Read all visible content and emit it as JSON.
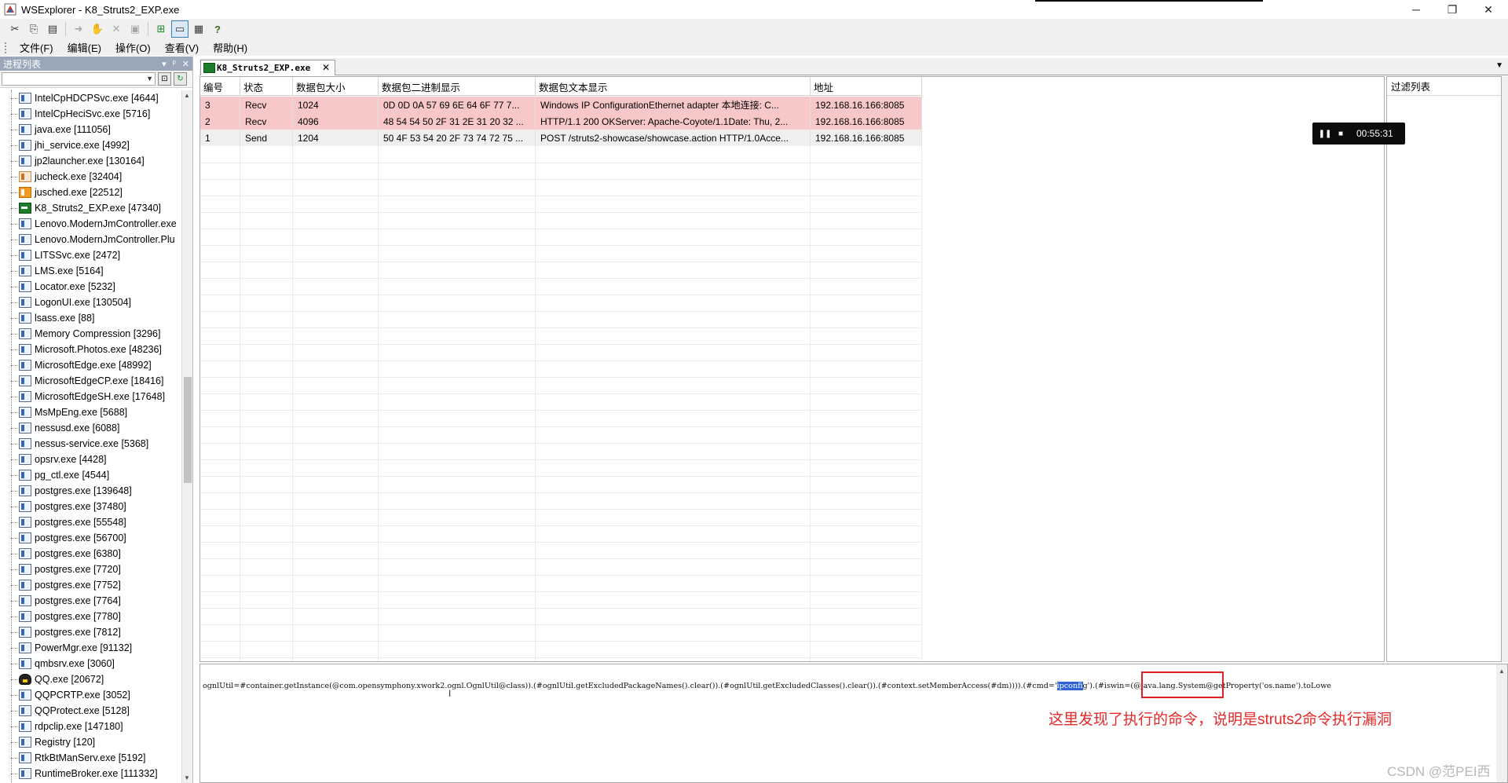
{
  "window": {
    "title": "WSExplorer - K8_Struts2_EXP.exe",
    "controls": {
      "minimize": "─",
      "restore": "❐",
      "close": "✕"
    }
  },
  "toolbar": {
    "buttons": [
      {
        "icon": "cut-icon",
        "glyph": "✂"
      },
      {
        "icon": "copy-icon",
        "glyph": "⎘"
      },
      {
        "icon": "paste-icon",
        "glyph": "▤"
      },
      {
        "icon": "forward-icon",
        "glyph": "➜"
      },
      {
        "icon": "hand-icon",
        "glyph": "✋"
      },
      {
        "icon": "delete-icon",
        "glyph": "✕"
      },
      {
        "icon": "save-icon",
        "glyph": "▣"
      },
      {
        "icon": "tree-view-icon",
        "glyph": "⊞"
      },
      {
        "icon": "window-icon",
        "glyph": "▭"
      },
      {
        "icon": "properties-icon",
        "glyph": "▦"
      },
      {
        "icon": "help-icon",
        "glyph": "?"
      }
    ]
  },
  "menubar": {
    "items": [
      "文件(F)",
      "编辑(E)",
      "操作(O)",
      "查看(V)",
      "帮助(H)"
    ]
  },
  "process_panel": {
    "title": "进程列表",
    "header_buttons": [
      "▾",
      "ᵖ",
      "✕"
    ],
    "processes": [
      {
        "label": "IntelCpHDCPSvc.exe [4644]",
        "icon": "app-icon"
      },
      {
        "label": "IntelCpHeciSvc.exe [5716]",
        "icon": "app-icon"
      },
      {
        "label": "java.exe [111056]",
        "icon": "app-icon"
      },
      {
        "label": "jhi_service.exe [4992]",
        "icon": "app-icon"
      },
      {
        "label": "jp2launcher.exe [130164]",
        "icon": "app-icon"
      },
      {
        "label": "jucheck.exe [32404]",
        "icon": "java-icon"
      },
      {
        "label": "jusched.exe [22512]",
        "icon": "java-orange-icon"
      },
      {
        "label": "K8_Struts2_EXP.exe [47340]",
        "icon": "k8-icon"
      },
      {
        "label": "Lenovo.ModernJmController.exe",
        "icon": "app-icon"
      },
      {
        "label": "Lenovo.ModernJmController.Plu",
        "icon": "app-icon"
      },
      {
        "label": "LITSSvc.exe [2472]",
        "icon": "app-icon"
      },
      {
        "label": "LMS.exe [5164]",
        "icon": "app-icon"
      },
      {
        "label": "Locator.exe [5232]",
        "icon": "app-icon"
      },
      {
        "label": "LogonUI.exe [130504]",
        "icon": "app-icon"
      },
      {
        "label": "lsass.exe [88]",
        "icon": "app-icon"
      },
      {
        "label": "Memory Compression [3296]",
        "icon": "app-icon"
      },
      {
        "label": "Microsoft.Photos.exe [48236]",
        "icon": "app-icon"
      },
      {
        "label": "MicrosoftEdge.exe [48992]",
        "icon": "app-icon"
      },
      {
        "label": "MicrosoftEdgeCP.exe [18416]",
        "icon": "app-icon"
      },
      {
        "label": "MicrosoftEdgeSH.exe [17648]",
        "icon": "app-icon"
      },
      {
        "label": "MsMpEng.exe [5688]",
        "icon": "app-icon"
      },
      {
        "label": "nessusd.exe [6088]",
        "icon": "app-icon"
      },
      {
        "label": "nessus-service.exe [5368]",
        "icon": "app-icon"
      },
      {
        "label": "opsrv.exe [4428]",
        "icon": "app-icon"
      },
      {
        "label": "pg_ctl.exe [4544]",
        "icon": "app-icon"
      },
      {
        "label": "postgres.exe [139648]",
        "icon": "app-icon"
      },
      {
        "label": "postgres.exe [37480]",
        "icon": "app-icon"
      },
      {
        "label": "postgres.exe [55548]",
        "icon": "app-icon"
      },
      {
        "label": "postgres.exe [56700]",
        "icon": "app-icon"
      },
      {
        "label": "postgres.exe [6380]",
        "icon": "app-icon"
      },
      {
        "label": "postgres.exe [7720]",
        "icon": "app-icon"
      },
      {
        "label": "postgres.exe [7752]",
        "icon": "app-icon"
      },
      {
        "label": "postgres.exe [7764]",
        "icon": "app-icon"
      },
      {
        "label": "postgres.exe [7780]",
        "icon": "app-icon"
      },
      {
        "label": "postgres.exe [7812]",
        "icon": "app-icon"
      },
      {
        "label": "PowerMgr.exe [91132]",
        "icon": "app-icon"
      },
      {
        "label": "qmbsrv.exe [3060]",
        "icon": "app-icon"
      },
      {
        "label": "QQ.exe [20672]",
        "icon": "qq-icon"
      },
      {
        "label": "QQPCRTP.exe [3052]",
        "icon": "app-icon"
      },
      {
        "label": "QQProtect.exe [5128]",
        "icon": "app-icon"
      },
      {
        "label": "rdpclip.exe [147180]",
        "icon": "app-icon"
      },
      {
        "label": "Registry [120]",
        "icon": "app-icon"
      },
      {
        "label": "RtkBtManServ.exe [5192]",
        "icon": "app-icon"
      },
      {
        "label": "RuntimeBroker.exe [111332]",
        "icon": "app-icon"
      }
    ]
  },
  "tab": {
    "label": "K8_Struts2_EXP.exe",
    "close": "✕",
    "menu_arrow": "▼"
  },
  "packet_table": {
    "columns": [
      "编号",
      "状态",
      "数据包大小",
      "数据包二进制显示",
      "数据包文本显示",
      "地址"
    ],
    "rows": [
      {
        "status_type": "recv",
        "cells": [
          "3",
          "Recv",
          "1024",
          "0D 0D 0A 57 69 6E 64 6F 77 7...",
          "Windows IP ConfigurationEthernet adapter 本地连接:   C...",
          "192.168.16.166:8085"
        ]
      },
      {
        "status_type": "recv",
        "cells": [
          "2",
          "Recv",
          "4096",
          "48 54 54 50 2F 31 2E 31 20 32 ...",
          "HTTP/1.1 200 OKServer: Apache-Coyote/1.1Date: Thu, 2...",
          "192.168.16.166:8085"
        ]
      },
      {
        "status_type": "send",
        "cells": [
          "1",
          "Send",
          "1204",
          "50 4F 53 54 20 2F 73 74 72 75 ...",
          "POST /struts2-showcase/showcase.action HTTP/1.0Acce...",
          "192.168.16.166:8085"
        ]
      }
    ],
    "colors": {
      "recv": "#f8c8c8",
      "send": "#efefef"
    }
  },
  "filter_panel": {
    "title": "过滤列表"
  },
  "media_overlay": {
    "pause": "❚❚",
    "stop": "■",
    "time": "00:55:31"
  },
  "detail_panel": {
    "code_before": "ognlUtil=#container.getInstance(@com.opensymphony.xwork2.ognl.OgnlUtil@class)).(#ognlUtil.getExcludedPackageNames().clear()).(#ognlUtil.getExcludedClasses().clear()).(#context.setMemberAccess(#dm)))).(#cmd='",
    "code_selected": "ipconf",
    "code_after": "ig').(#iswin=(@java.lang.System@getProperty('os.name').toLowe",
    "annotation": "这里发现了执行的命令，说明是struts2命令执行漏洞",
    "highlight_color": "#e02020"
  },
  "watermark": "CSDN @范PEI西"
}
